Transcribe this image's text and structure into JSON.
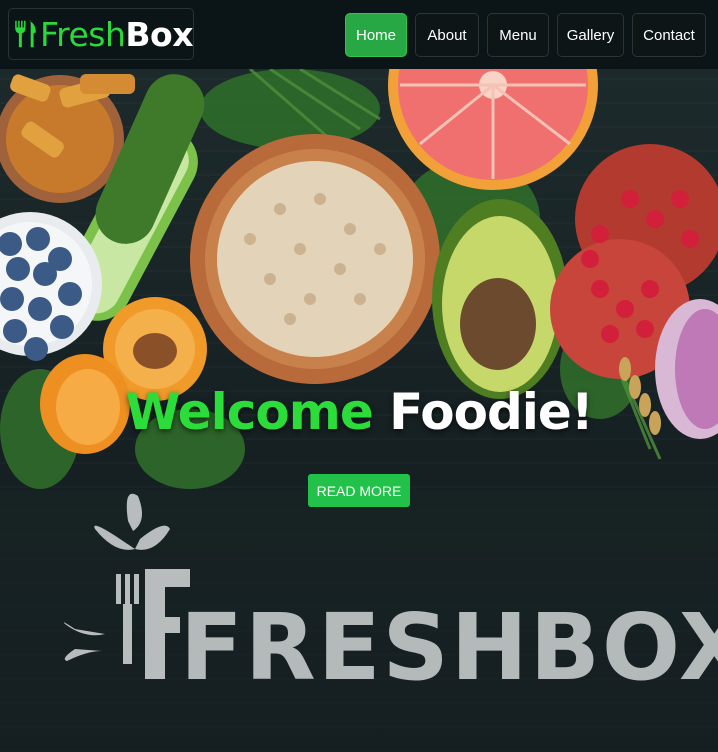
{
  "brand": {
    "word1": "Fresh",
    "word2": "Box",
    "icon": "fork-knife-icon",
    "color_fresh": "#2bd93c"
  },
  "nav": {
    "items": [
      {
        "label": "Home",
        "active": true
      },
      {
        "label": "About",
        "active": false
      },
      {
        "label": "Menu",
        "active": false
      },
      {
        "label": "Gallery",
        "active": false
      },
      {
        "label": "Contact",
        "active": false
      }
    ],
    "active_color": "#28a745"
  },
  "hero": {
    "heading_part1": "Welcome",
    "heading_part2": "Foodie!",
    "cta_label": "READ MORE",
    "logo_text": "FRESHBOX"
  }
}
